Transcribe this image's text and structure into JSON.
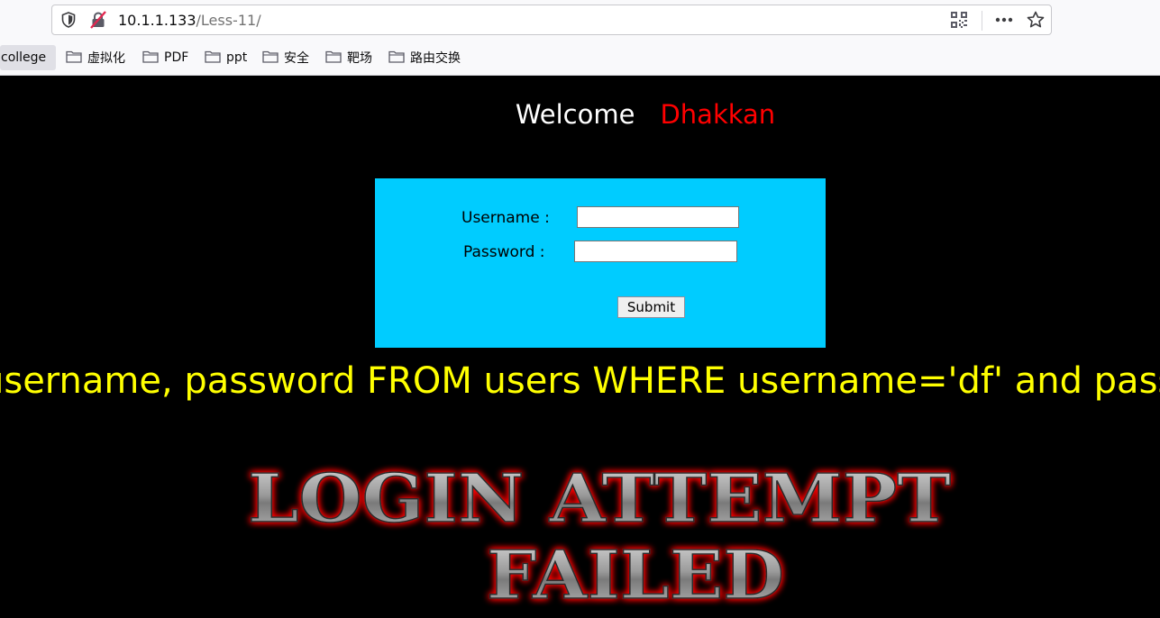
{
  "browser": {
    "url_host": "10.1.1.133",
    "url_path": "/Less-11/",
    "bookmarks": [
      {
        "label": "college"
      },
      {
        "label": "虚拟化"
      },
      {
        "label": "PDF"
      },
      {
        "label": "ppt"
      },
      {
        "label": "安全"
      },
      {
        "label": "靶场"
      },
      {
        "label": "路由交换"
      }
    ]
  },
  "page": {
    "welcome_word": "Welcome",
    "welcome_name": "Dhakkan",
    "form": {
      "username_label": "Username :",
      "password_label": "Password :",
      "username_value": "",
      "password_value": "",
      "submit_label": "Submit"
    },
    "query_text": "username, password FROM users WHERE username='df' and password",
    "failed_line1": "LOGIN ATTEMPT",
    "failed_line2": "FAILED"
  },
  "colors": {
    "form_background": "#00ccff",
    "query_text": "#ffff00",
    "welcome_name": "#ff0000",
    "failed_glow": "#ff0000"
  },
  "icons": [
    "shield-icon",
    "insecure-lock-icon",
    "qr-code-icon",
    "more-icon",
    "star-icon",
    "folder-icon"
  ]
}
